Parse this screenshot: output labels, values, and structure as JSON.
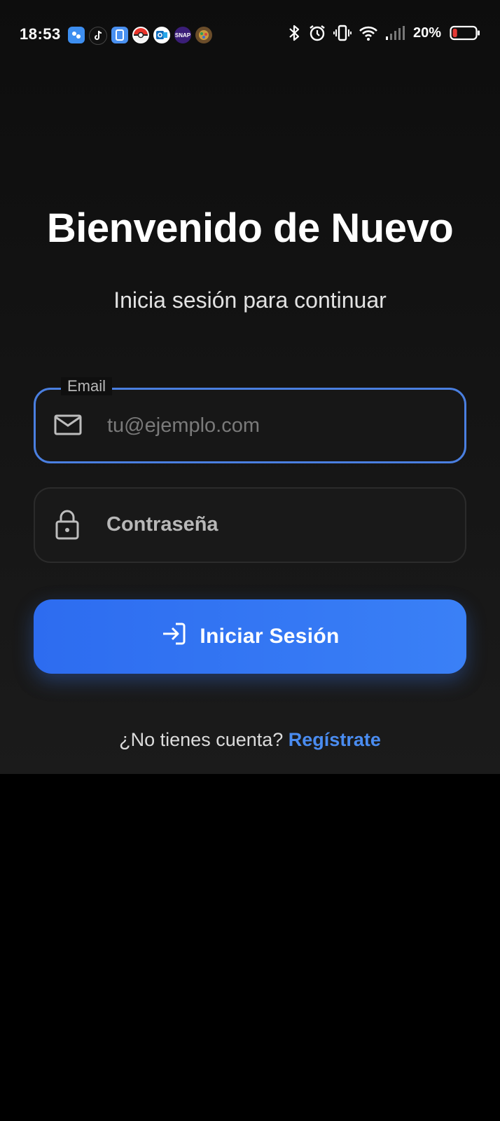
{
  "status_bar": {
    "time": "18:53",
    "battery_percent": "20%",
    "battery_level": 0.2,
    "notification_icons": [
      "app-icon-blue",
      "tiktok-icon",
      "phone-icon",
      "pokeball-icon",
      "outlook-icon",
      "snap-icon",
      "game-icon"
    ],
    "snap_icon_text": "SNAP"
  },
  "login": {
    "title": "Bienvenido de Nuevo",
    "subtitle": "Inicia sesión para continuar",
    "email": {
      "label": "Email",
      "placeholder": "tu@ejemplo.com",
      "value": ""
    },
    "password": {
      "placeholder": "Contraseña",
      "value": ""
    },
    "submit_label": "Iniciar Sesión",
    "register_prompt": "¿No tienes cuenta?",
    "register_link": "Regístrate"
  },
  "colors": {
    "accent": "#3a7cf4",
    "link": "#4a8cf0",
    "background": "#111111"
  }
}
